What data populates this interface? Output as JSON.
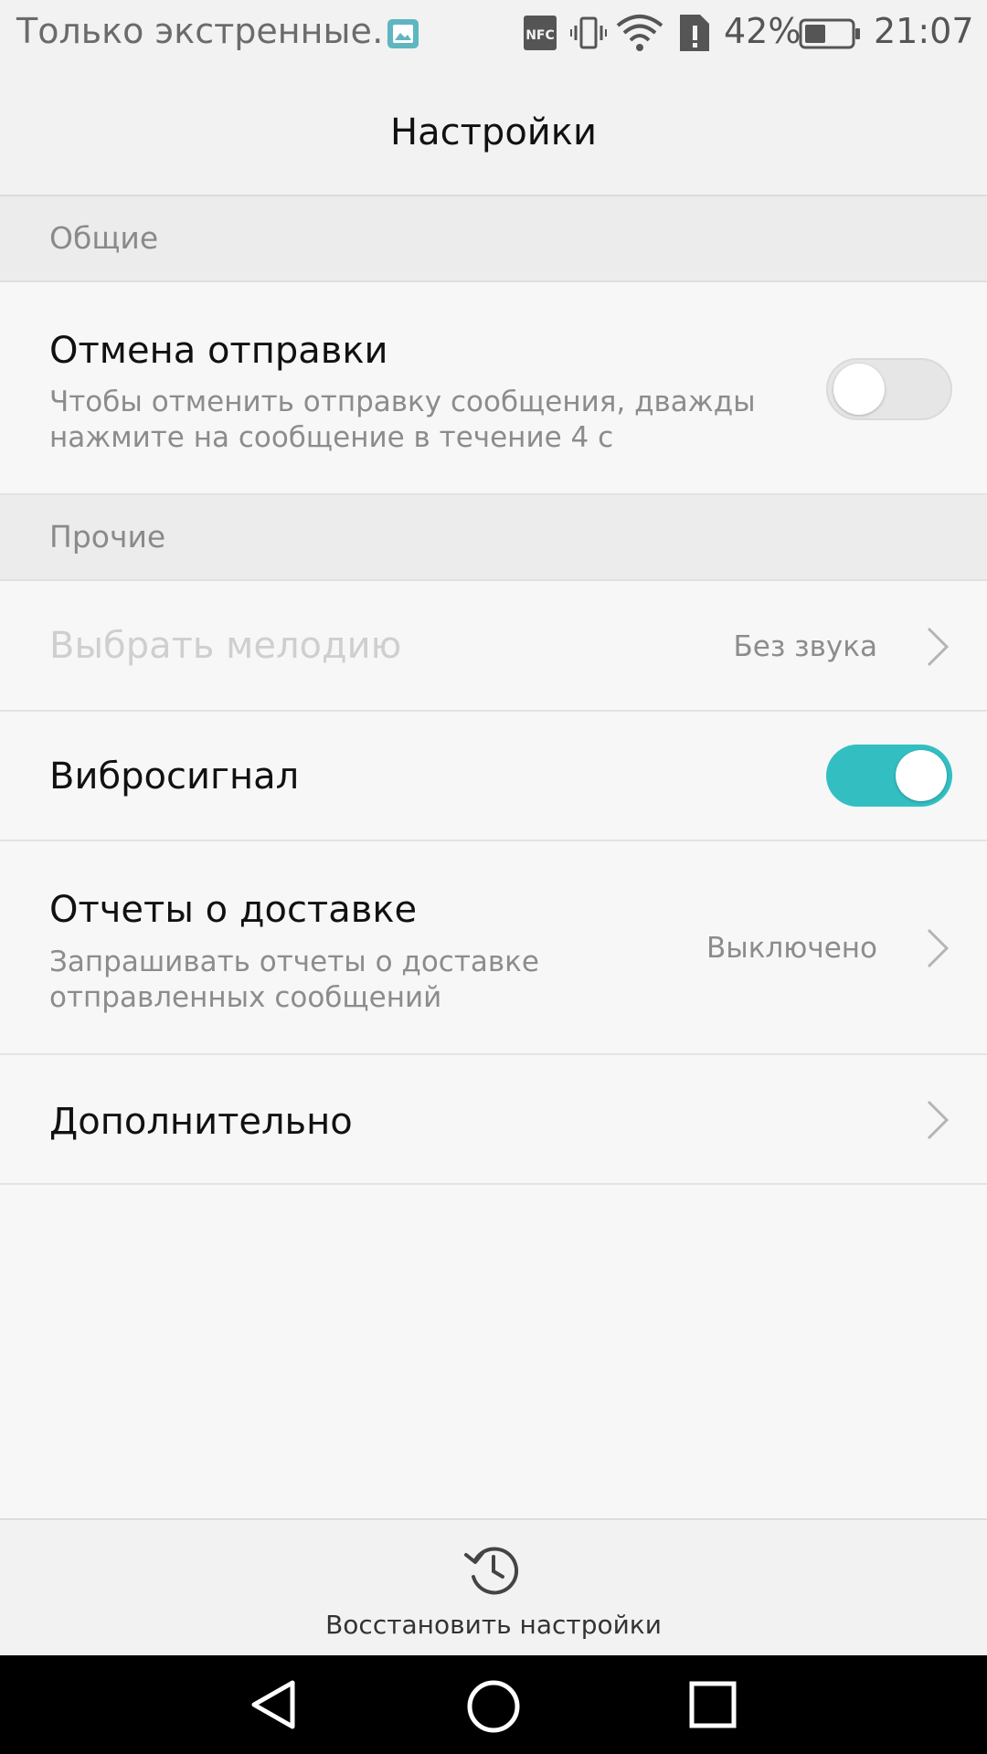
{
  "status_bar": {
    "notification_text": "Только экстренные…",
    "battery_percent": "42%",
    "time": "21:07",
    "icons": [
      "gallery-icon",
      "nfc-icon",
      "vibrate-icon",
      "wifi-icon",
      "sim-alert-icon",
      "battery-icon"
    ]
  },
  "app_bar": {
    "title": "Настройки"
  },
  "sections": {
    "general": {
      "label": "Общие"
    },
    "other": {
      "label": "Прочие"
    }
  },
  "settings": {
    "cancel_send": {
      "title": "Отмена отправки",
      "subtitle_line1": "Чтобы отменить отправку сообщения, дважды",
      "subtitle_line2": "нажмите на сообщение в течение 4 с",
      "enabled": false
    },
    "ringtone": {
      "title": "Выбрать мелодию",
      "value": "Без звука",
      "disabled": true
    },
    "vibration": {
      "title": "Вибросигнал",
      "enabled": true
    },
    "delivery_reports": {
      "title": "Отчеты о доставке",
      "subtitle_line1": "Запрашивать отчеты о доставке",
      "subtitle_line2": "отправленных сообщений",
      "value": "Выключено"
    },
    "advanced": {
      "title": "Дополнительно"
    }
  },
  "bottom_action": {
    "label": "Восстановить настройки"
  },
  "colors": {
    "accent": "#33bfc2",
    "background": "#f7f7f7",
    "section_header": "#ececec"
  }
}
